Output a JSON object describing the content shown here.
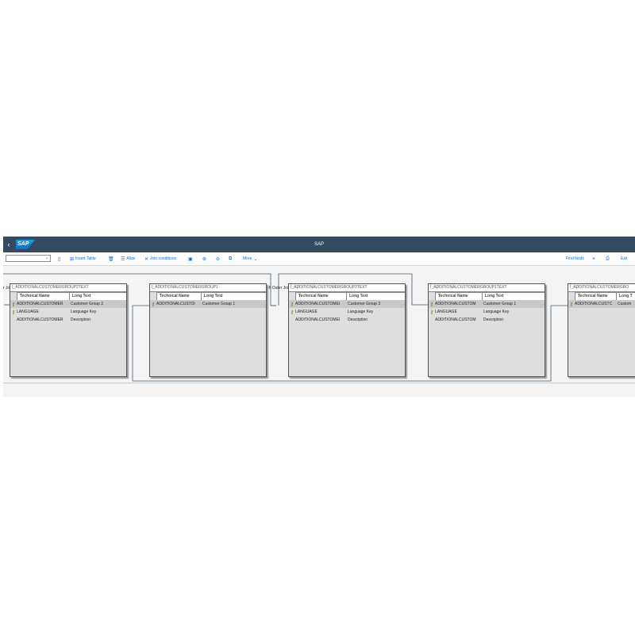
{
  "shell": {
    "back_icon": "back-arrow-icon",
    "logo_text": "SAP",
    "title": "SAP"
  },
  "toolbar": {
    "select_value": "",
    "insert_table": "Insert Table",
    "alias": "Alias",
    "join_conditions": "Join conditions",
    "more": "More",
    "find_fields": "Find fields",
    "exit": "Exit"
  },
  "join_labels": [
    "r Join",
    "Left Outer Join"
  ],
  "tables": [
    {
      "name": "I_ADDITIONALCUSTOMERGROUP2TEXT",
      "col1": "Technical Name",
      "col2": "Long Text",
      "rows": [
        {
          "key": true,
          "tech": "ADDITIONALCUSTOMER",
          "text": "Customer Group 2"
        },
        {
          "key": true,
          "tech": "LANGUAGE",
          "text": "Language Key"
        },
        {
          "key": false,
          "tech": "ADDITIONALCUSTOMER",
          "text": "Description"
        }
      ]
    },
    {
      "name": "I_ADDITIONALCUSTOMERGROUP1",
      "col1": "Technical Name",
      "col2": "Long Text",
      "rows": [
        {
          "key": true,
          "tech": "ADDITIONALCUSTOI",
          "text": "Customer Group 1"
        }
      ]
    },
    {
      "name": "I_ADDITIONALCUSTOMERGROUP3TEXT",
      "col1": "Technical Name",
      "col2": "Long Text",
      "rows": [
        {
          "key": true,
          "tech": "ADDITIONALCUSTOMEI",
          "text": "Customer Group 3"
        },
        {
          "key": true,
          "tech": "LANGUAGE",
          "text": "Language Key"
        },
        {
          "key": false,
          "tech": "ADDITIONALCUSTOMEI",
          "text": "Description"
        }
      ]
    },
    {
      "name": "I_ADDITIONALCUSTOMERGROUP1TEXT",
      "col1": "Technical Name",
      "col2": "Long Text",
      "rows": [
        {
          "key": true,
          "tech": "ADDITIONALCUSTOM",
          "text": "Customer Group 1"
        },
        {
          "key": true,
          "tech": "LANGUAGE",
          "text": "Language Key"
        },
        {
          "key": false,
          "tech": "ADDITIONALCUSTOM",
          "text": "Description"
        }
      ]
    },
    {
      "name": "I_ADDITIONALCUSTOMERGRO",
      "col1": "Technical Name",
      "col2": "Long T",
      "rows": [
        {
          "key": true,
          "tech": "ADDITIONALCUSTC",
          "text": "Custom"
        }
      ]
    }
  ]
}
